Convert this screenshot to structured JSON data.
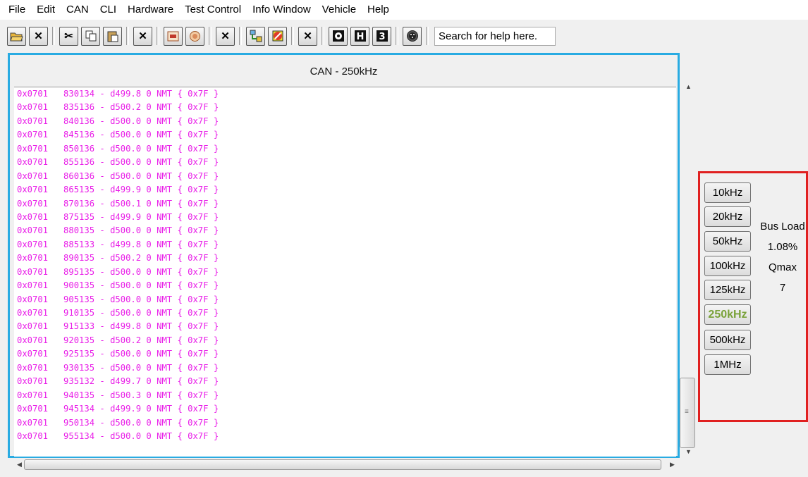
{
  "menubar": {
    "items": [
      "File",
      "Edit",
      "CAN",
      "CLI",
      "Hardware",
      "Test Control",
      "Info Window",
      "Vehicle",
      "Help"
    ]
  },
  "toolbar": {
    "search_placeholder": "Search for help here."
  },
  "can_window": {
    "title": "CAN - 250kHz",
    "lines": [
      "0x0701   830134 - d499.8 0 NMT { 0x7F }",
      "0x0701   835136 - d500.2 0 NMT { 0x7F }",
      "0x0701   840136 - d500.0 0 NMT { 0x7F }",
      "0x0701   845136 - d500.0 0 NMT { 0x7F }",
      "0x0701   850136 - d500.0 0 NMT { 0x7F }",
      "0x0701   855136 - d500.0 0 NMT { 0x7F }",
      "0x0701   860136 - d500.0 0 NMT { 0x7F }",
      "0x0701   865135 - d499.9 0 NMT { 0x7F }",
      "0x0701   870136 - d500.1 0 NMT { 0x7F }",
      "0x0701   875135 - d499.9 0 NMT { 0x7F }",
      "0x0701   880135 - d500.0 0 NMT { 0x7F }",
      "0x0701   885133 - d499.8 0 NMT { 0x7F }",
      "0x0701   890135 - d500.2 0 NMT { 0x7F }",
      "0x0701   895135 - d500.0 0 NMT { 0x7F }",
      "0x0701   900135 - d500.0 0 NMT { 0x7F }",
      "0x0701   905135 - d500.0 0 NMT { 0x7F }",
      "0x0701   910135 - d500.0 0 NMT { 0x7F }",
      "0x0701   915133 - d499.8 0 NMT { 0x7F }",
      "0x0701   920135 - d500.2 0 NMT { 0x7F }",
      "0x0701   925135 - d500.0 0 NMT { 0x7F }",
      "0x0701   930135 - d500.0 0 NMT { 0x7F }",
      "0x0701   935132 - d499.7 0 NMT { 0x7F }",
      "0x0701   940135 - d500.3 0 NMT { 0x7F }",
      "0x0701   945134 - d499.9 0 NMT { 0x7F }",
      "0x0701   950134 - d500.0 0 NMT { 0x7F }",
      "0x0701   955134 - d500.0 0 NMT { 0x7F }"
    ]
  },
  "bitrates": {
    "buttons": [
      "10kHz",
      "20kHz",
      "50kHz",
      "100kHz",
      "125kHz",
      "250kHz",
      "500kHz",
      "1MHz"
    ],
    "selected": "250kHz"
  },
  "stats": {
    "bus_load_label": "Bus Load",
    "bus_load_value": "1.08%",
    "qmax_label": "Qmax",
    "qmax_value": "7"
  },
  "colors": {
    "log_text": "#e91ee8",
    "pane_border": "#29abe2",
    "panel_border": "#e02020",
    "active_rate": "#7aa23a"
  }
}
